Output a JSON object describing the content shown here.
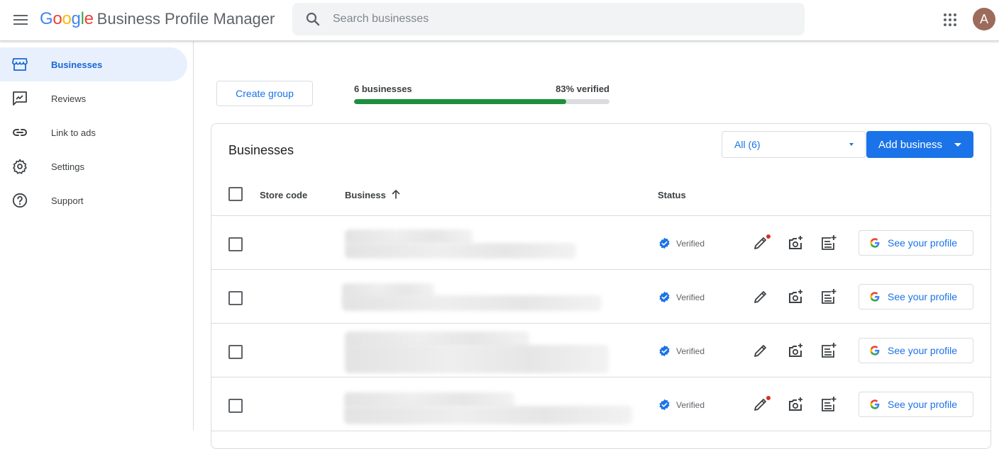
{
  "header": {
    "logo_google_letters": [
      {
        "ch": "G",
        "color": "#4285F4"
      },
      {
        "ch": "o",
        "color": "#EA4335"
      },
      {
        "ch": "o",
        "color": "#FBBC05"
      },
      {
        "ch": "g",
        "color": "#4285F4"
      },
      {
        "ch": "l",
        "color": "#34A853"
      },
      {
        "ch": "e",
        "color": "#EA4335"
      }
    ],
    "product_name": "Business Profile Manager",
    "search_placeholder": "Search businesses",
    "avatar_initial": "A",
    "icons": {
      "menu": "hamburger-menu-icon",
      "search": "search-icon",
      "apps": "apps-grid-icon"
    }
  },
  "sidebar": {
    "items": [
      {
        "label": "Businesses",
        "icon": "storefront-icon",
        "active": true
      },
      {
        "label": "Reviews",
        "icon": "reviews-icon",
        "active": false
      },
      {
        "label": "Link to ads",
        "icon": "link-icon",
        "active": false
      },
      {
        "label": "Settings",
        "icon": "gear-icon",
        "active": false
      },
      {
        "label": "Support",
        "icon": "help-icon",
        "active": false
      }
    ]
  },
  "summary": {
    "create_group_label": "Create group",
    "count_label": "6 businesses",
    "verified_label": "83% verified",
    "verified_fraction": 0.83
  },
  "card": {
    "title": "Businesses",
    "filter_value": "All (6)",
    "add_business_label": "Add business"
  },
  "table": {
    "columns": {
      "store_code": "Store code",
      "business": "Business",
      "status": "Status"
    },
    "rows": [
      {
        "status": "Verified",
        "edit_has_alert": true,
        "profile_label": "See your profile"
      },
      {
        "status": "Verified",
        "edit_has_alert": false,
        "profile_label": "See your profile"
      },
      {
        "status": "Verified",
        "edit_has_alert": false,
        "profile_label": "See your profile"
      },
      {
        "status": "Verified",
        "edit_has_alert": true,
        "profile_label": "See your profile"
      }
    ]
  },
  "colors": {
    "accent": "#1a73e8",
    "progress": "#1e8e3e",
    "verified": "#1a73e8",
    "alert_dot": "#d93025",
    "active_nav_bg": "#e8f0fe"
  }
}
